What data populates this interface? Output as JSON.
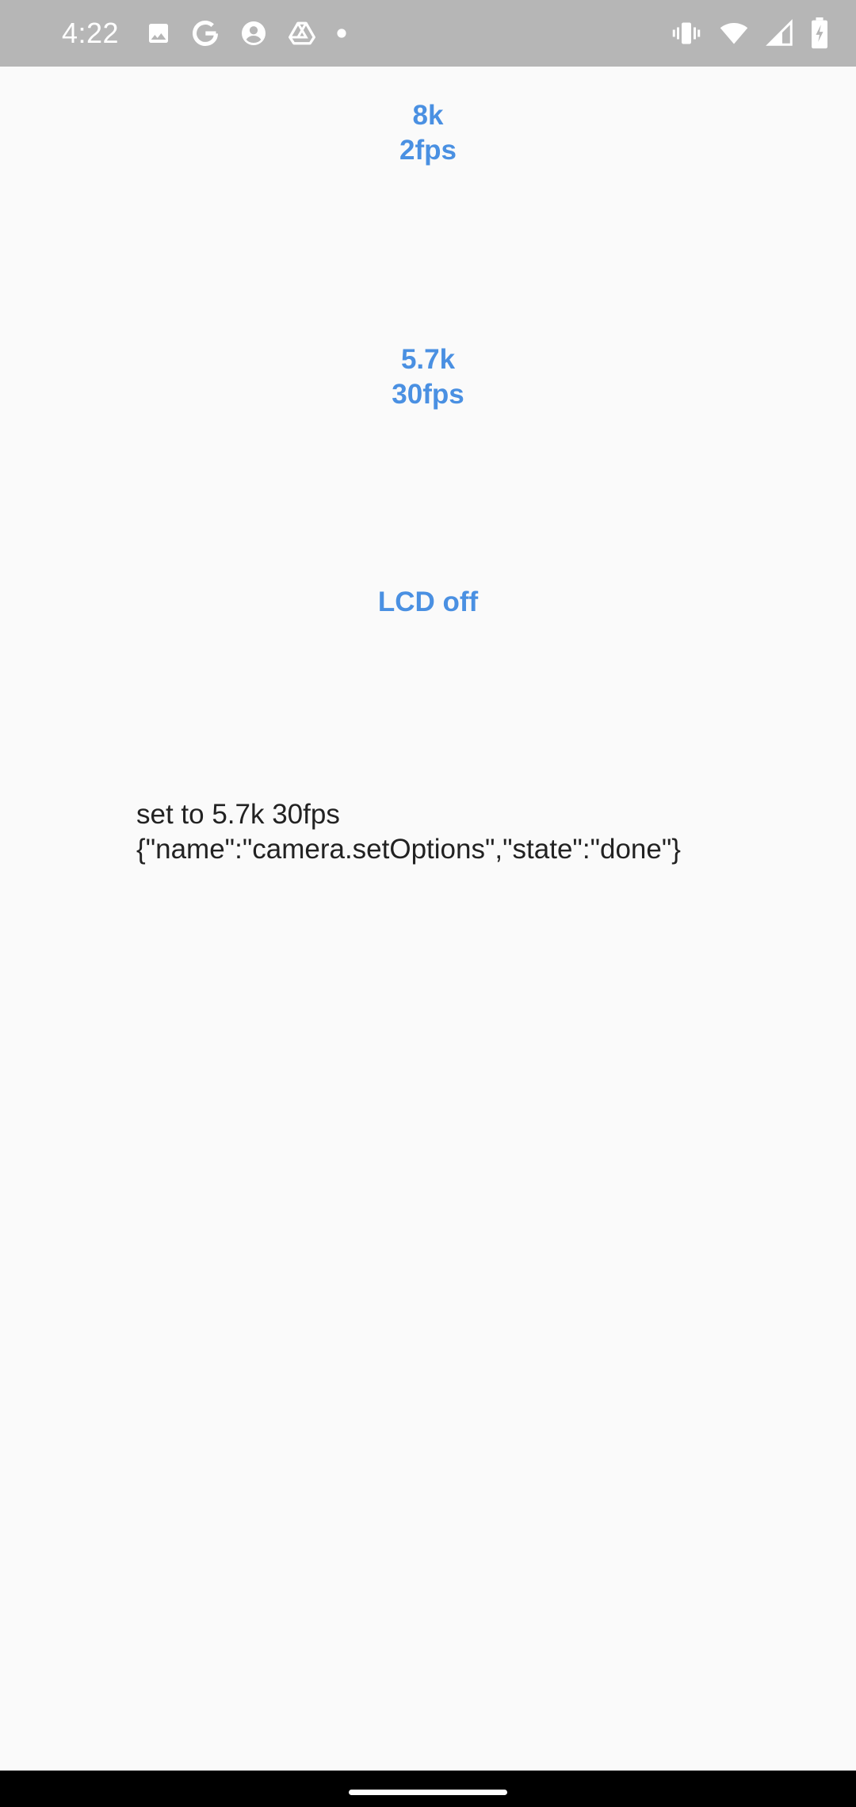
{
  "status_bar": {
    "time": "4:22",
    "left_icons": [
      "image-icon",
      "google-icon",
      "account-icon",
      "drive-icon",
      "dot-icon"
    ],
    "right_icons": [
      "vibrate-icon",
      "wifi-icon",
      "signal-icon",
      "battery-charging-icon"
    ]
  },
  "buttons": {
    "res_8k": {
      "line1": "8k",
      "line2": "2fps"
    },
    "res_57k": {
      "line1": "5.7k",
      "line2": "30fps"
    },
    "lcd": {
      "label": "LCD off"
    }
  },
  "result": {
    "line1": "set to 5.7k 30fps",
    "line2": "{\"name\":\"camera.setOptions\",\"state\":\"done\"}"
  },
  "colors": {
    "status_bar": "#b6b6b6",
    "accent": "#4a90e2",
    "background": "#fafafa",
    "text": "#222222",
    "nav_bar": "#000000"
  }
}
